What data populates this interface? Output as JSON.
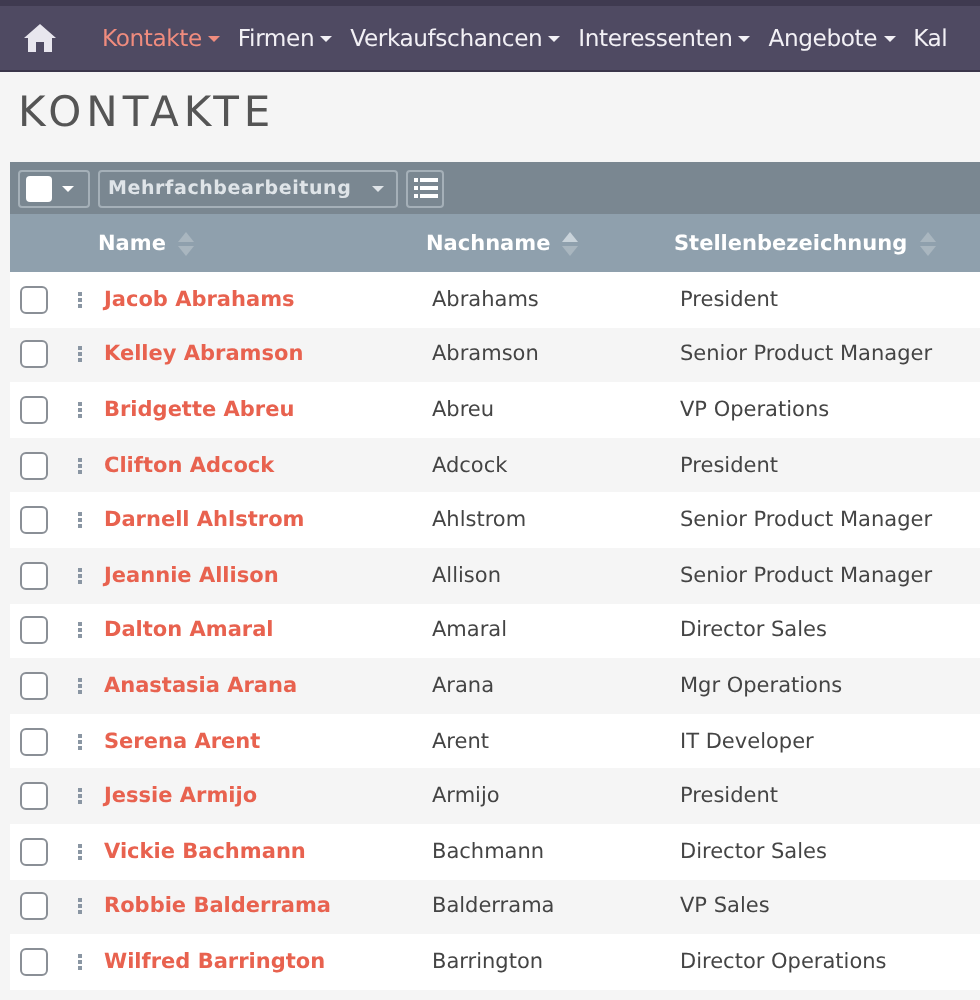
{
  "nav": {
    "items": [
      {
        "label": "Kontakte",
        "selected": true
      },
      {
        "label": "Firmen",
        "selected": false
      },
      {
        "label": "Verkaufschancen",
        "selected": false
      },
      {
        "label": "Interessenten",
        "selected": false
      },
      {
        "label": "Angebote",
        "selected": false
      },
      {
        "label": "Kal",
        "selected": false
      }
    ]
  },
  "page_title": "KONTAKTE",
  "toolbar": {
    "bulk_action": "Mehrfachbearbeitung"
  },
  "table": {
    "columns": [
      "Name",
      "Nachname",
      "Stellenbezeichnung"
    ],
    "rows": [
      {
        "name": "Jacob Abrahams",
        "last_name": "Abrahams",
        "title": "President",
        "checked": false
      },
      {
        "name": "Kelley Abramson",
        "last_name": "Abramson",
        "title": "Senior Product Manager",
        "checked": false
      },
      {
        "name": "Bridgette Abreu",
        "last_name": "Abreu",
        "title": "VP Operations",
        "checked": false
      },
      {
        "name": "Clifton Adcock",
        "last_name": "Adcock",
        "title": "President",
        "checked": false
      },
      {
        "name": "Darnell Ahlstrom",
        "last_name": "Ahlstrom",
        "title": "Senior Product Manager",
        "checked": false
      },
      {
        "name": "Jeannie Allison",
        "last_name": "Allison",
        "title": "Senior Product Manager",
        "checked": false
      },
      {
        "name": "Dalton Amaral",
        "last_name": "Amaral",
        "title": "Director Sales",
        "checked": false
      },
      {
        "name": "Anastasia Arana",
        "last_name": "Arana",
        "title": "Mgr Operations",
        "checked": false
      },
      {
        "name": "Serena Arent",
        "last_name": "Arent",
        "title": "IT Developer",
        "checked": false
      },
      {
        "name": "Jessie Armijo",
        "last_name": "Armijo",
        "title": "President",
        "checked": false
      },
      {
        "name": "Vickie Bachmann",
        "last_name": "Bachmann",
        "title": "Director Sales",
        "checked": false
      },
      {
        "name": "Robbie Balderrama",
        "last_name": "Balderrama",
        "title": "VP Sales",
        "checked": false
      },
      {
        "name": "Wilfred Barrington",
        "last_name": "Barrington",
        "title": "Director Operations",
        "checked": false
      }
    ]
  }
}
